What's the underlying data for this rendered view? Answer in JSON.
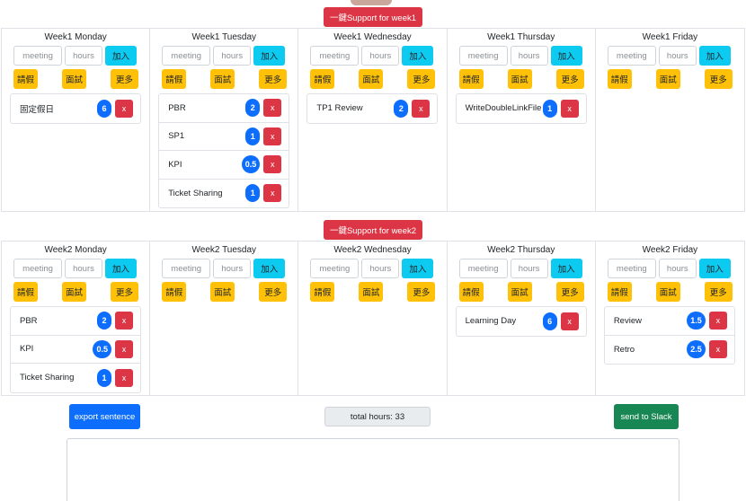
{
  "weeks": [
    {
      "support_label": "一鍵Support for week1",
      "days": [
        {
          "title": "Week1 Monday",
          "meeting_placeholder": "meeting",
          "hours_placeholder": "hours",
          "add_label": "加入",
          "leave_label": "請假",
          "interview_label": "面試",
          "more_label": "更多",
          "tasks": [
            {
              "name": "固定假日",
              "hours": "6",
              "delete_label": "x"
            }
          ]
        },
        {
          "title": "Week1 Tuesday",
          "meeting_placeholder": "meeting",
          "hours_placeholder": "hours",
          "add_label": "加入",
          "leave_label": "請假",
          "interview_label": "面試",
          "more_label": "更多",
          "tasks": [
            {
              "name": "PBR",
              "hours": "2",
              "delete_label": "x"
            },
            {
              "name": "SP1",
              "hours": "1",
              "delete_label": "x"
            },
            {
              "name": "KPI",
              "hours": "0.5",
              "delete_label": "x"
            },
            {
              "name": "Ticket Sharing",
              "hours": "1",
              "delete_label": "x"
            }
          ]
        },
        {
          "title": "Week1 Wednesday",
          "meeting_placeholder": "meeting",
          "hours_placeholder": "hours",
          "add_label": "加入",
          "leave_label": "請假",
          "interview_label": "面試",
          "more_label": "更多",
          "tasks": [
            {
              "name": "TP1 Review",
              "hours": "2",
              "delete_label": "x"
            }
          ]
        },
        {
          "title": "Week1 Thursday",
          "meeting_placeholder": "meeting",
          "hours_placeholder": "hours",
          "add_label": "加入",
          "leave_label": "請假",
          "interview_label": "面試",
          "more_label": "更多",
          "tasks": [
            {
              "name": "WriteDoubleLinkFile",
              "hours": "1",
              "delete_label": "x"
            }
          ]
        },
        {
          "title": "Week1 Friday",
          "meeting_placeholder": "meeting",
          "hours_placeholder": "hours",
          "add_label": "加入",
          "leave_label": "請假",
          "interview_label": "面試",
          "more_label": "更多",
          "tasks": []
        }
      ]
    },
    {
      "support_label": "一鍵Support for week2",
      "days": [
        {
          "title": "Week2 Monday",
          "meeting_placeholder": "meeting",
          "hours_placeholder": "hours",
          "add_label": "加入",
          "leave_label": "請假",
          "interview_label": "面試",
          "more_label": "更多",
          "tasks": [
            {
              "name": "PBR",
              "hours": "2",
              "delete_label": "x"
            },
            {
              "name": "KPI",
              "hours": "0.5",
              "delete_label": "x"
            },
            {
              "name": "Ticket Sharing",
              "hours": "1",
              "delete_label": "x"
            }
          ]
        },
        {
          "title": "Week2 Tuesday",
          "meeting_placeholder": "meeting",
          "hours_placeholder": "hours",
          "add_label": "加入",
          "leave_label": "請假",
          "interview_label": "面試",
          "more_label": "更多",
          "tasks": []
        },
        {
          "title": "Week2 Wednesday",
          "meeting_placeholder": "meeting",
          "hours_placeholder": "hours",
          "add_label": "加入",
          "leave_label": "請假",
          "interview_label": "面試",
          "more_label": "更多",
          "tasks": []
        },
        {
          "title": "Week2 Thursday",
          "meeting_placeholder": "meeting",
          "hours_placeholder": "hours",
          "add_label": "加入",
          "leave_label": "請假",
          "interview_label": "面試",
          "more_label": "更多",
          "tasks": [
            {
              "name": "Learning Day",
              "hours": "6",
              "delete_label": "x"
            }
          ]
        },
        {
          "title": "Week2 Friday",
          "meeting_placeholder": "meeting",
          "hours_placeholder": "hours",
          "add_label": "加入",
          "leave_label": "請假",
          "interview_label": "面試",
          "more_label": "更多",
          "tasks": [
            {
              "name": "Review",
              "hours": "1.5",
              "delete_label": "x"
            },
            {
              "name": "Retro",
              "hours": "2.5",
              "delete_label": "x"
            }
          ]
        }
      ]
    }
  ],
  "footer": {
    "export_label": "export sentence",
    "total_label": "total hours: 33",
    "slack_label": "send to Slack"
  },
  "colors": {
    "danger": "#dc3545",
    "info": "#0dcaf0",
    "warning": "#ffc107",
    "primary": "#0d6efd",
    "success": "#198754"
  }
}
